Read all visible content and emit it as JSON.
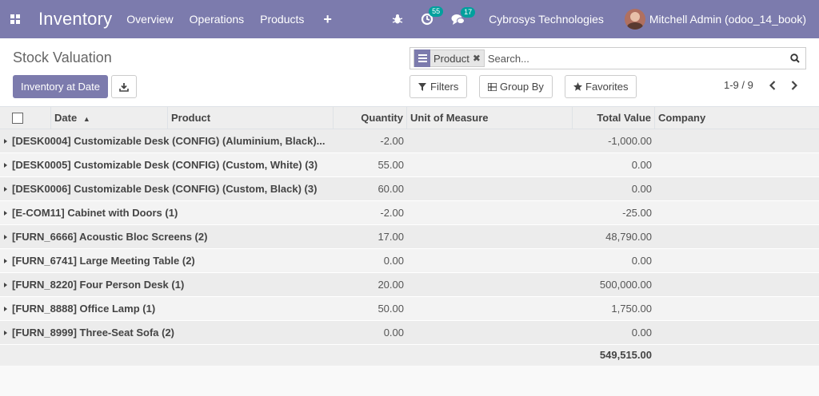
{
  "navbar": {
    "app_name": "Inventory",
    "menu": [
      "Overview",
      "Operations",
      "Products"
    ],
    "plus": "+",
    "activity_count": "55",
    "message_count": "17",
    "company": "Cybrosys Technologies",
    "user": "Mitchell Admin (odoo_14_book)"
  },
  "control": {
    "title": "Stock Valuation",
    "inventory_at_date": "Inventory at Date",
    "facet_label": "Product",
    "search_placeholder": "Search...",
    "filters": "Filters",
    "group_by": "Group By",
    "favorites": "Favorites",
    "pager": "1-9 / 9"
  },
  "table": {
    "columns": {
      "date": "Date",
      "product": "Product",
      "quantity": "Quantity",
      "uom": "Unit of Measure",
      "total_value": "Total Value",
      "company": "Company"
    },
    "rows": [
      {
        "label": "[DESK0004] Customizable Desk (CONFIG) (Aluminium, Black)...",
        "quantity": "-2.00",
        "total": "-1,000.00"
      },
      {
        "label": "[DESK0005] Customizable Desk (CONFIG) (Custom, White) (3)",
        "quantity": "55.00",
        "total": "0.00"
      },
      {
        "label": "[DESK0006] Customizable Desk (CONFIG) (Custom, Black) (3)",
        "quantity": "60.00",
        "total": "0.00"
      },
      {
        "label": "[E-COM11] Cabinet with Doors (1)",
        "quantity": "-2.00",
        "total": "-25.00"
      },
      {
        "label": "[FURN_6666] Acoustic Bloc Screens (2)",
        "quantity": "17.00",
        "total": "48,790.00"
      },
      {
        "label": "[FURN_6741] Large Meeting Table (2)",
        "quantity": "0.00",
        "total": "0.00"
      },
      {
        "label": "[FURN_8220] Four Person Desk (1)",
        "quantity": "20.00",
        "total": "500,000.00"
      },
      {
        "label": "[FURN_8888] Office Lamp (1)",
        "quantity": "50.00",
        "total": "1,750.00"
      },
      {
        "label": "[FURN_8999] Three-Seat Sofa (2)",
        "quantity": "0.00",
        "total": "0.00"
      }
    ],
    "footer_total": "549,515.00"
  },
  "colors": {
    "brand": "#7c7bad",
    "badge": "#00a09d"
  }
}
